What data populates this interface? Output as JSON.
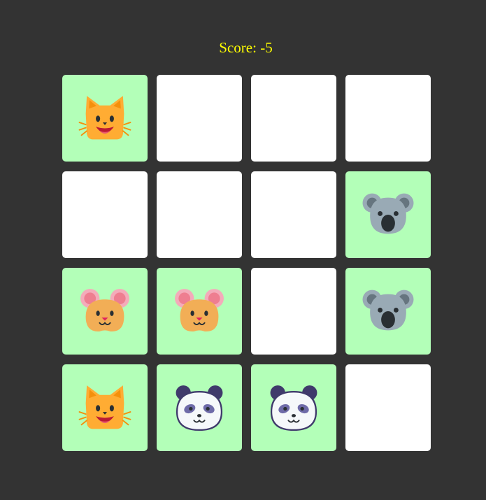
{
  "score_text": "Score: -5",
  "colors": {
    "background": "#333333",
    "score": "#ffff00",
    "matched_card": "#b3ffb8",
    "hidden_card": "#ffffff"
  },
  "board": {
    "rows": 4,
    "cols": 4,
    "cards": [
      {
        "state": "matched",
        "animal": "cat"
      },
      {
        "state": "hidden"
      },
      {
        "state": "hidden"
      },
      {
        "state": "hidden"
      },
      {
        "state": "hidden"
      },
      {
        "state": "hidden"
      },
      {
        "state": "hidden"
      },
      {
        "state": "matched",
        "animal": "koala"
      },
      {
        "state": "matched",
        "animal": "mouse"
      },
      {
        "state": "matched",
        "animal": "mouse"
      },
      {
        "state": "hidden"
      },
      {
        "state": "matched",
        "animal": "koala"
      },
      {
        "state": "matched",
        "animal": "cat"
      },
      {
        "state": "matched",
        "animal": "panda"
      },
      {
        "state": "matched",
        "animal": "panda"
      },
      {
        "state": "hidden"
      }
    ]
  }
}
